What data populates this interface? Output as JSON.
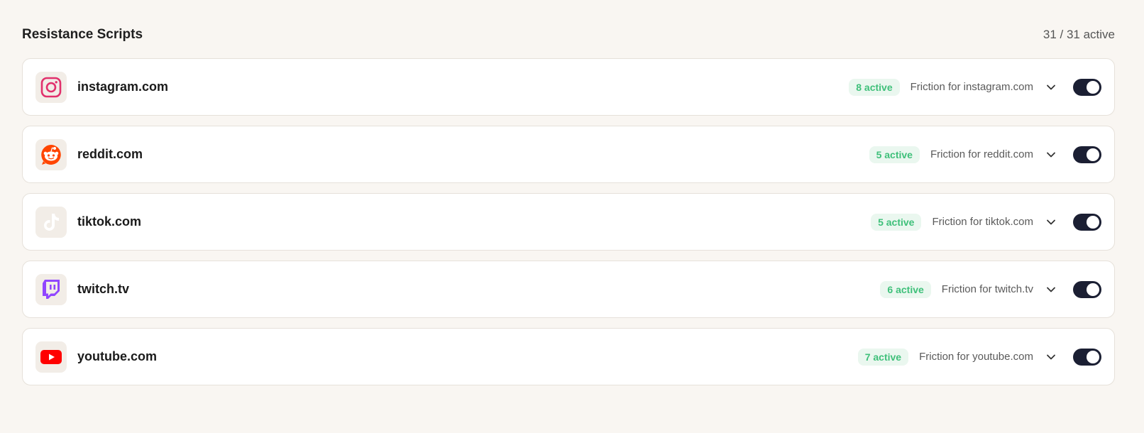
{
  "header": {
    "title": "Resistance Scripts",
    "count": "31 / 31 active"
  },
  "sites": [
    {
      "domain": "instagram.com",
      "badge": "8 active",
      "description": "Friction for instagram.com",
      "icon": "instagram-icon",
      "enabled": true
    },
    {
      "domain": "reddit.com",
      "badge": "5 active",
      "description": "Friction for reddit.com",
      "icon": "reddit-icon",
      "enabled": true
    },
    {
      "domain": "tiktok.com",
      "badge": "5 active",
      "description": "Friction for tiktok.com",
      "icon": "tiktok-icon",
      "enabled": true
    },
    {
      "domain": "twitch.tv",
      "badge": "6 active",
      "description": "Friction for twitch.tv",
      "icon": "twitch-icon",
      "enabled": true
    },
    {
      "domain": "youtube.com",
      "badge": "7 active",
      "description": "Friction for youtube.com",
      "icon": "youtube-icon",
      "enabled": true
    }
  ],
  "colors": {
    "badge_text": "#3fc07a",
    "badge_bg": "#eaf7ef",
    "toggle_on": "#1b1f33",
    "instagram": "#e1306c",
    "reddit": "#ff4500",
    "tiktok": "#ffffff",
    "twitch": "#9146ff",
    "youtube": "#ff0000"
  }
}
